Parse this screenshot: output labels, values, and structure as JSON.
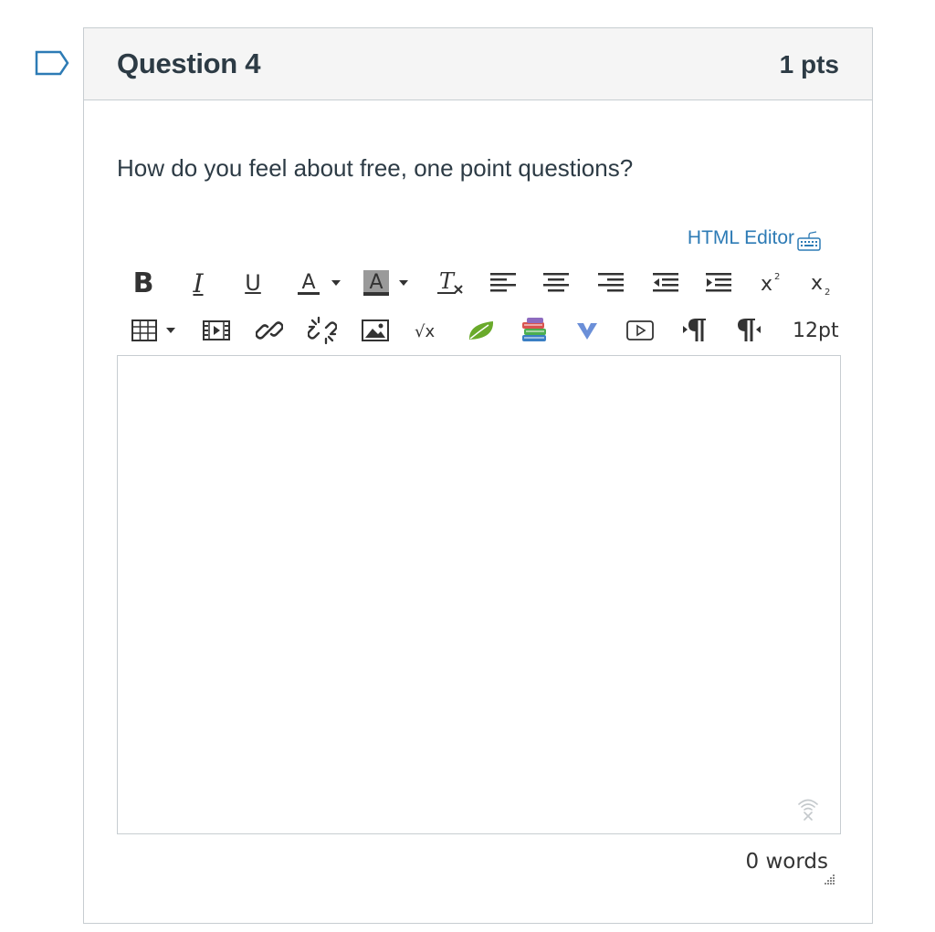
{
  "question": {
    "title": "Question 4",
    "points": "1 pts",
    "text": "How do you feel about free, one point questions?"
  },
  "editor": {
    "html_editor_label": "HTML Editor",
    "font_size": "12pt",
    "word_count": "0 words"
  },
  "toolbar": {
    "row1": [
      "bold-icon",
      "italic-icon",
      "underline-icon",
      "text-color-icon",
      "background-color-icon",
      "clear-formatting-icon",
      "align-left-icon",
      "align-center-icon",
      "align-right-icon",
      "outdent-icon",
      "indent-icon",
      "superscript-icon",
      "subscript-icon"
    ],
    "row2": [
      "table-icon",
      "media-icon",
      "link-icon",
      "unlink-icon",
      "image-icon",
      "equation-icon",
      "leaf-icon",
      "books-icon",
      "vimeo-icon",
      "video-icon",
      "ltr-icon",
      "rtl-icon",
      "font-size"
    ],
    "icon_labels": {
      "bold": "B",
      "italic": "I",
      "underline": "U",
      "text_color": "A",
      "bg_color": "A",
      "clear": "T",
      "sqrt": "√x",
      "sup": "x",
      "sub": "x"
    }
  },
  "colors": {
    "accent": "#2d7bb5",
    "text": "#2d3b45",
    "border": "#c7cdd1",
    "header_bg": "#f5f5f5"
  }
}
